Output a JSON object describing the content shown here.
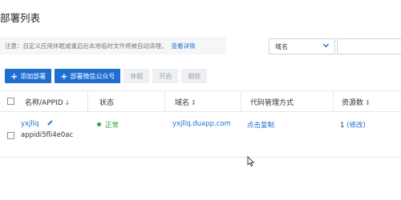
{
  "page": {
    "title": "部署列表"
  },
  "notice": {
    "text": "注意：自定义应用休眠或重启后本地临时文件将被自动清理。",
    "link": "查看详情"
  },
  "filter": {
    "selected": "域名",
    "search_value": ""
  },
  "toolbar": {
    "add_deploy": "添加部署",
    "deploy_wechat": "部署微信公众号",
    "hibernate": "休眠",
    "start": "开启",
    "delete": "删除"
  },
  "table": {
    "headers": {
      "name_appid": "名称/APPID",
      "status": "状态",
      "domain": "域名",
      "code_mgmt": "代码管理方式",
      "resources": "资源数"
    },
    "rows": [
      {
        "name": "yxjllq",
        "appid": "appidi5fli4e0ac",
        "status": "正常",
        "domain": "yxjllq.duapp.com",
        "code_mgmt": "点击复制",
        "resources_count": "1",
        "resources_action": "(修改)"
      }
    ]
  },
  "colors": {
    "primary": "#1f6fd1",
    "success": "#27a84a",
    "border": "#e3e7ec"
  }
}
